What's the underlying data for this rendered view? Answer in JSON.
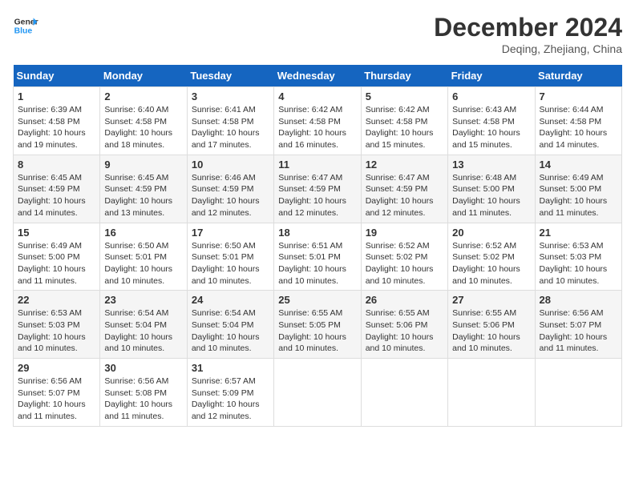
{
  "header": {
    "logo_line1": "General",
    "logo_line2": "Blue",
    "month": "December 2024",
    "location": "Deqing, Zhejiang, China"
  },
  "weekdays": [
    "Sunday",
    "Monday",
    "Tuesday",
    "Wednesday",
    "Thursday",
    "Friday",
    "Saturday"
  ],
  "weeks": [
    [
      {
        "day": "1",
        "info": "Sunrise: 6:39 AM\nSunset: 4:58 PM\nDaylight: 10 hours\nand 19 minutes."
      },
      {
        "day": "2",
        "info": "Sunrise: 6:40 AM\nSunset: 4:58 PM\nDaylight: 10 hours\nand 18 minutes."
      },
      {
        "day": "3",
        "info": "Sunrise: 6:41 AM\nSunset: 4:58 PM\nDaylight: 10 hours\nand 17 minutes."
      },
      {
        "day": "4",
        "info": "Sunrise: 6:42 AM\nSunset: 4:58 PM\nDaylight: 10 hours\nand 16 minutes."
      },
      {
        "day": "5",
        "info": "Sunrise: 6:42 AM\nSunset: 4:58 PM\nDaylight: 10 hours\nand 15 minutes."
      },
      {
        "day": "6",
        "info": "Sunrise: 6:43 AM\nSunset: 4:58 PM\nDaylight: 10 hours\nand 15 minutes."
      },
      {
        "day": "7",
        "info": "Sunrise: 6:44 AM\nSunset: 4:58 PM\nDaylight: 10 hours\nand 14 minutes."
      }
    ],
    [
      {
        "day": "8",
        "info": "Sunrise: 6:45 AM\nSunset: 4:59 PM\nDaylight: 10 hours\nand 14 minutes."
      },
      {
        "day": "9",
        "info": "Sunrise: 6:45 AM\nSunset: 4:59 PM\nDaylight: 10 hours\nand 13 minutes."
      },
      {
        "day": "10",
        "info": "Sunrise: 6:46 AM\nSunset: 4:59 PM\nDaylight: 10 hours\nand 12 minutes."
      },
      {
        "day": "11",
        "info": "Sunrise: 6:47 AM\nSunset: 4:59 PM\nDaylight: 10 hours\nand 12 minutes."
      },
      {
        "day": "12",
        "info": "Sunrise: 6:47 AM\nSunset: 4:59 PM\nDaylight: 10 hours\nand 12 minutes."
      },
      {
        "day": "13",
        "info": "Sunrise: 6:48 AM\nSunset: 5:00 PM\nDaylight: 10 hours\nand 11 minutes."
      },
      {
        "day": "14",
        "info": "Sunrise: 6:49 AM\nSunset: 5:00 PM\nDaylight: 10 hours\nand 11 minutes."
      }
    ],
    [
      {
        "day": "15",
        "info": "Sunrise: 6:49 AM\nSunset: 5:00 PM\nDaylight: 10 hours\nand 11 minutes."
      },
      {
        "day": "16",
        "info": "Sunrise: 6:50 AM\nSunset: 5:01 PM\nDaylight: 10 hours\nand 10 minutes."
      },
      {
        "day": "17",
        "info": "Sunrise: 6:50 AM\nSunset: 5:01 PM\nDaylight: 10 hours\nand 10 minutes."
      },
      {
        "day": "18",
        "info": "Sunrise: 6:51 AM\nSunset: 5:01 PM\nDaylight: 10 hours\nand 10 minutes."
      },
      {
        "day": "19",
        "info": "Sunrise: 6:52 AM\nSunset: 5:02 PM\nDaylight: 10 hours\nand 10 minutes."
      },
      {
        "day": "20",
        "info": "Sunrise: 6:52 AM\nSunset: 5:02 PM\nDaylight: 10 hours\nand 10 minutes."
      },
      {
        "day": "21",
        "info": "Sunrise: 6:53 AM\nSunset: 5:03 PM\nDaylight: 10 hours\nand 10 minutes."
      }
    ],
    [
      {
        "day": "22",
        "info": "Sunrise: 6:53 AM\nSunset: 5:03 PM\nDaylight: 10 hours\nand 10 minutes."
      },
      {
        "day": "23",
        "info": "Sunrise: 6:54 AM\nSunset: 5:04 PM\nDaylight: 10 hours\nand 10 minutes."
      },
      {
        "day": "24",
        "info": "Sunrise: 6:54 AM\nSunset: 5:04 PM\nDaylight: 10 hours\nand 10 minutes."
      },
      {
        "day": "25",
        "info": "Sunrise: 6:55 AM\nSunset: 5:05 PM\nDaylight: 10 hours\nand 10 minutes."
      },
      {
        "day": "26",
        "info": "Sunrise: 6:55 AM\nSunset: 5:06 PM\nDaylight: 10 hours\nand 10 minutes."
      },
      {
        "day": "27",
        "info": "Sunrise: 6:55 AM\nSunset: 5:06 PM\nDaylight: 10 hours\nand 10 minutes."
      },
      {
        "day": "28",
        "info": "Sunrise: 6:56 AM\nSunset: 5:07 PM\nDaylight: 10 hours\nand 11 minutes."
      }
    ],
    [
      {
        "day": "29",
        "info": "Sunrise: 6:56 AM\nSunset: 5:07 PM\nDaylight: 10 hours\nand 11 minutes."
      },
      {
        "day": "30",
        "info": "Sunrise: 6:56 AM\nSunset: 5:08 PM\nDaylight: 10 hours\nand 11 minutes."
      },
      {
        "day": "31",
        "info": "Sunrise: 6:57 AM\nSunset: 5:09 PM\nDaylight: 10 hours\nand 12 minutes."
      },
      {
        "day": "",
        "info": ""
      },
      {
        "day": "",
        "info": ""
      },
      {
        "day": "",
        "info": ""
      },
      {
        "day": "",
        "info": ""
      }
    ]
  ]
}
